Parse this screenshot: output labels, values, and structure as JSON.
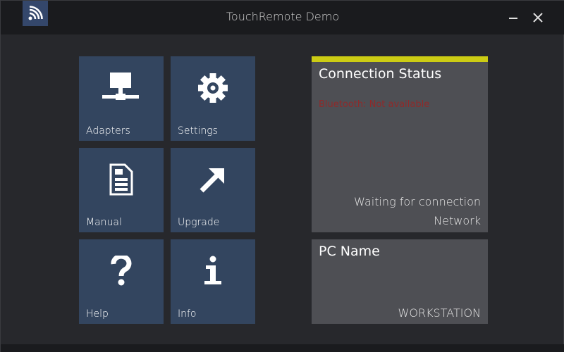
{
  "window": {
    "title": "TouchRemote Demo",
    "app_icon": "wifi-signal-icon",
    "controls": {
      "minimize": "minimize-icon",
      "close": "close-icon"
    }
  },
  "tiles": [
    {
      "label": "Adapters",
      "icon": "network-icon"
    },
    {
      "label": "Settings",
      "icon": "gear-icon"
    },
    {
      "label": "Manual",
      "icon": "document-icon"
    },
    {
      "label": "Upgrade",
      "icon": "arrow-up-right-icon"
    },
    {
      "label": "Help",
      "icon": "question-icon"
    },
    {
      "label": "Info",
      "icon": "info-icon"
    }
  ],
  "connection_status": {
    "title": "Connection Status",
    "bluetooth": "Bluetooth: Not available",
    "state": "Waiting for connection",
    "network": "Network",
    "accent_color": "#cccc14",
    "bluetooth_color": "#8f2a2a"
  },
  "pc_name": {
    "title": "PC Name",
    "value": "WORKSTATION"
  },
  "colors": {
    "tile": "#33455f",
    "panel": "#4e4f54",
    "background": "#27282c",
    "titlebar": "#1a1b1e"
  }
}
